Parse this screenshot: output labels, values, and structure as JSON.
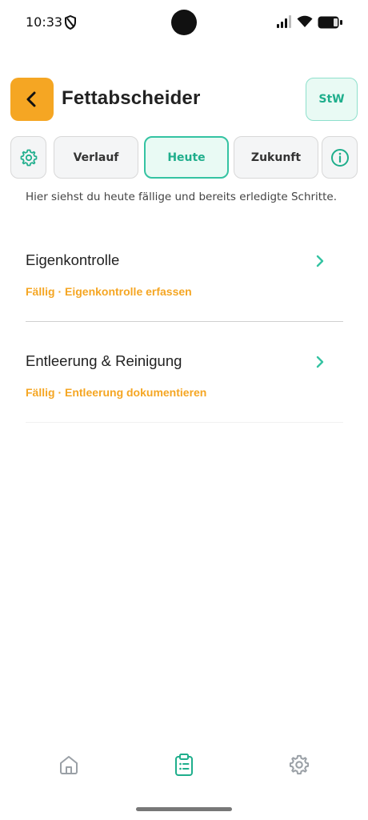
{
  "status_bar": {
    "time": "10:33"
  },
  "header": {
    "title": "Fettabscheider",
    "user_initials": "StW"
  },
  "tabs": [
    {
      "label": "Verlauf",
      "active": false
    },
    {
      "label": "Heute",
      "active": true
    },
    {
      "label": "Zukunft",
      "active": false
    }
  ],
  "hint": "Hier siehst du heute fällige und bereits erledigte Schritte.",
  "tasks": [
    {
      "title": "Eigenkontrolle",
      "status": "Fällig · Eigenkontrolle erfassen"
    },
    {
      "title": "Entleerung & Reinigung",
      "status": "Fällig · Entleerung dokumentieren"
    }
  ],
  "bottom_nav": [
    {
      "icon": "home-icon",
      "active": false
    },
    {
      "icon": "clipboard-list-icon",
      "active": true
    },
    {
      "icon": "gear-icon",
      "active": false
    }
  ],
  "colors": {
    "accent_orange": "#F5A623",
    "accent_teal": "#34C3A2",
    "teal_text": "#1FAE8C"
  }
}
